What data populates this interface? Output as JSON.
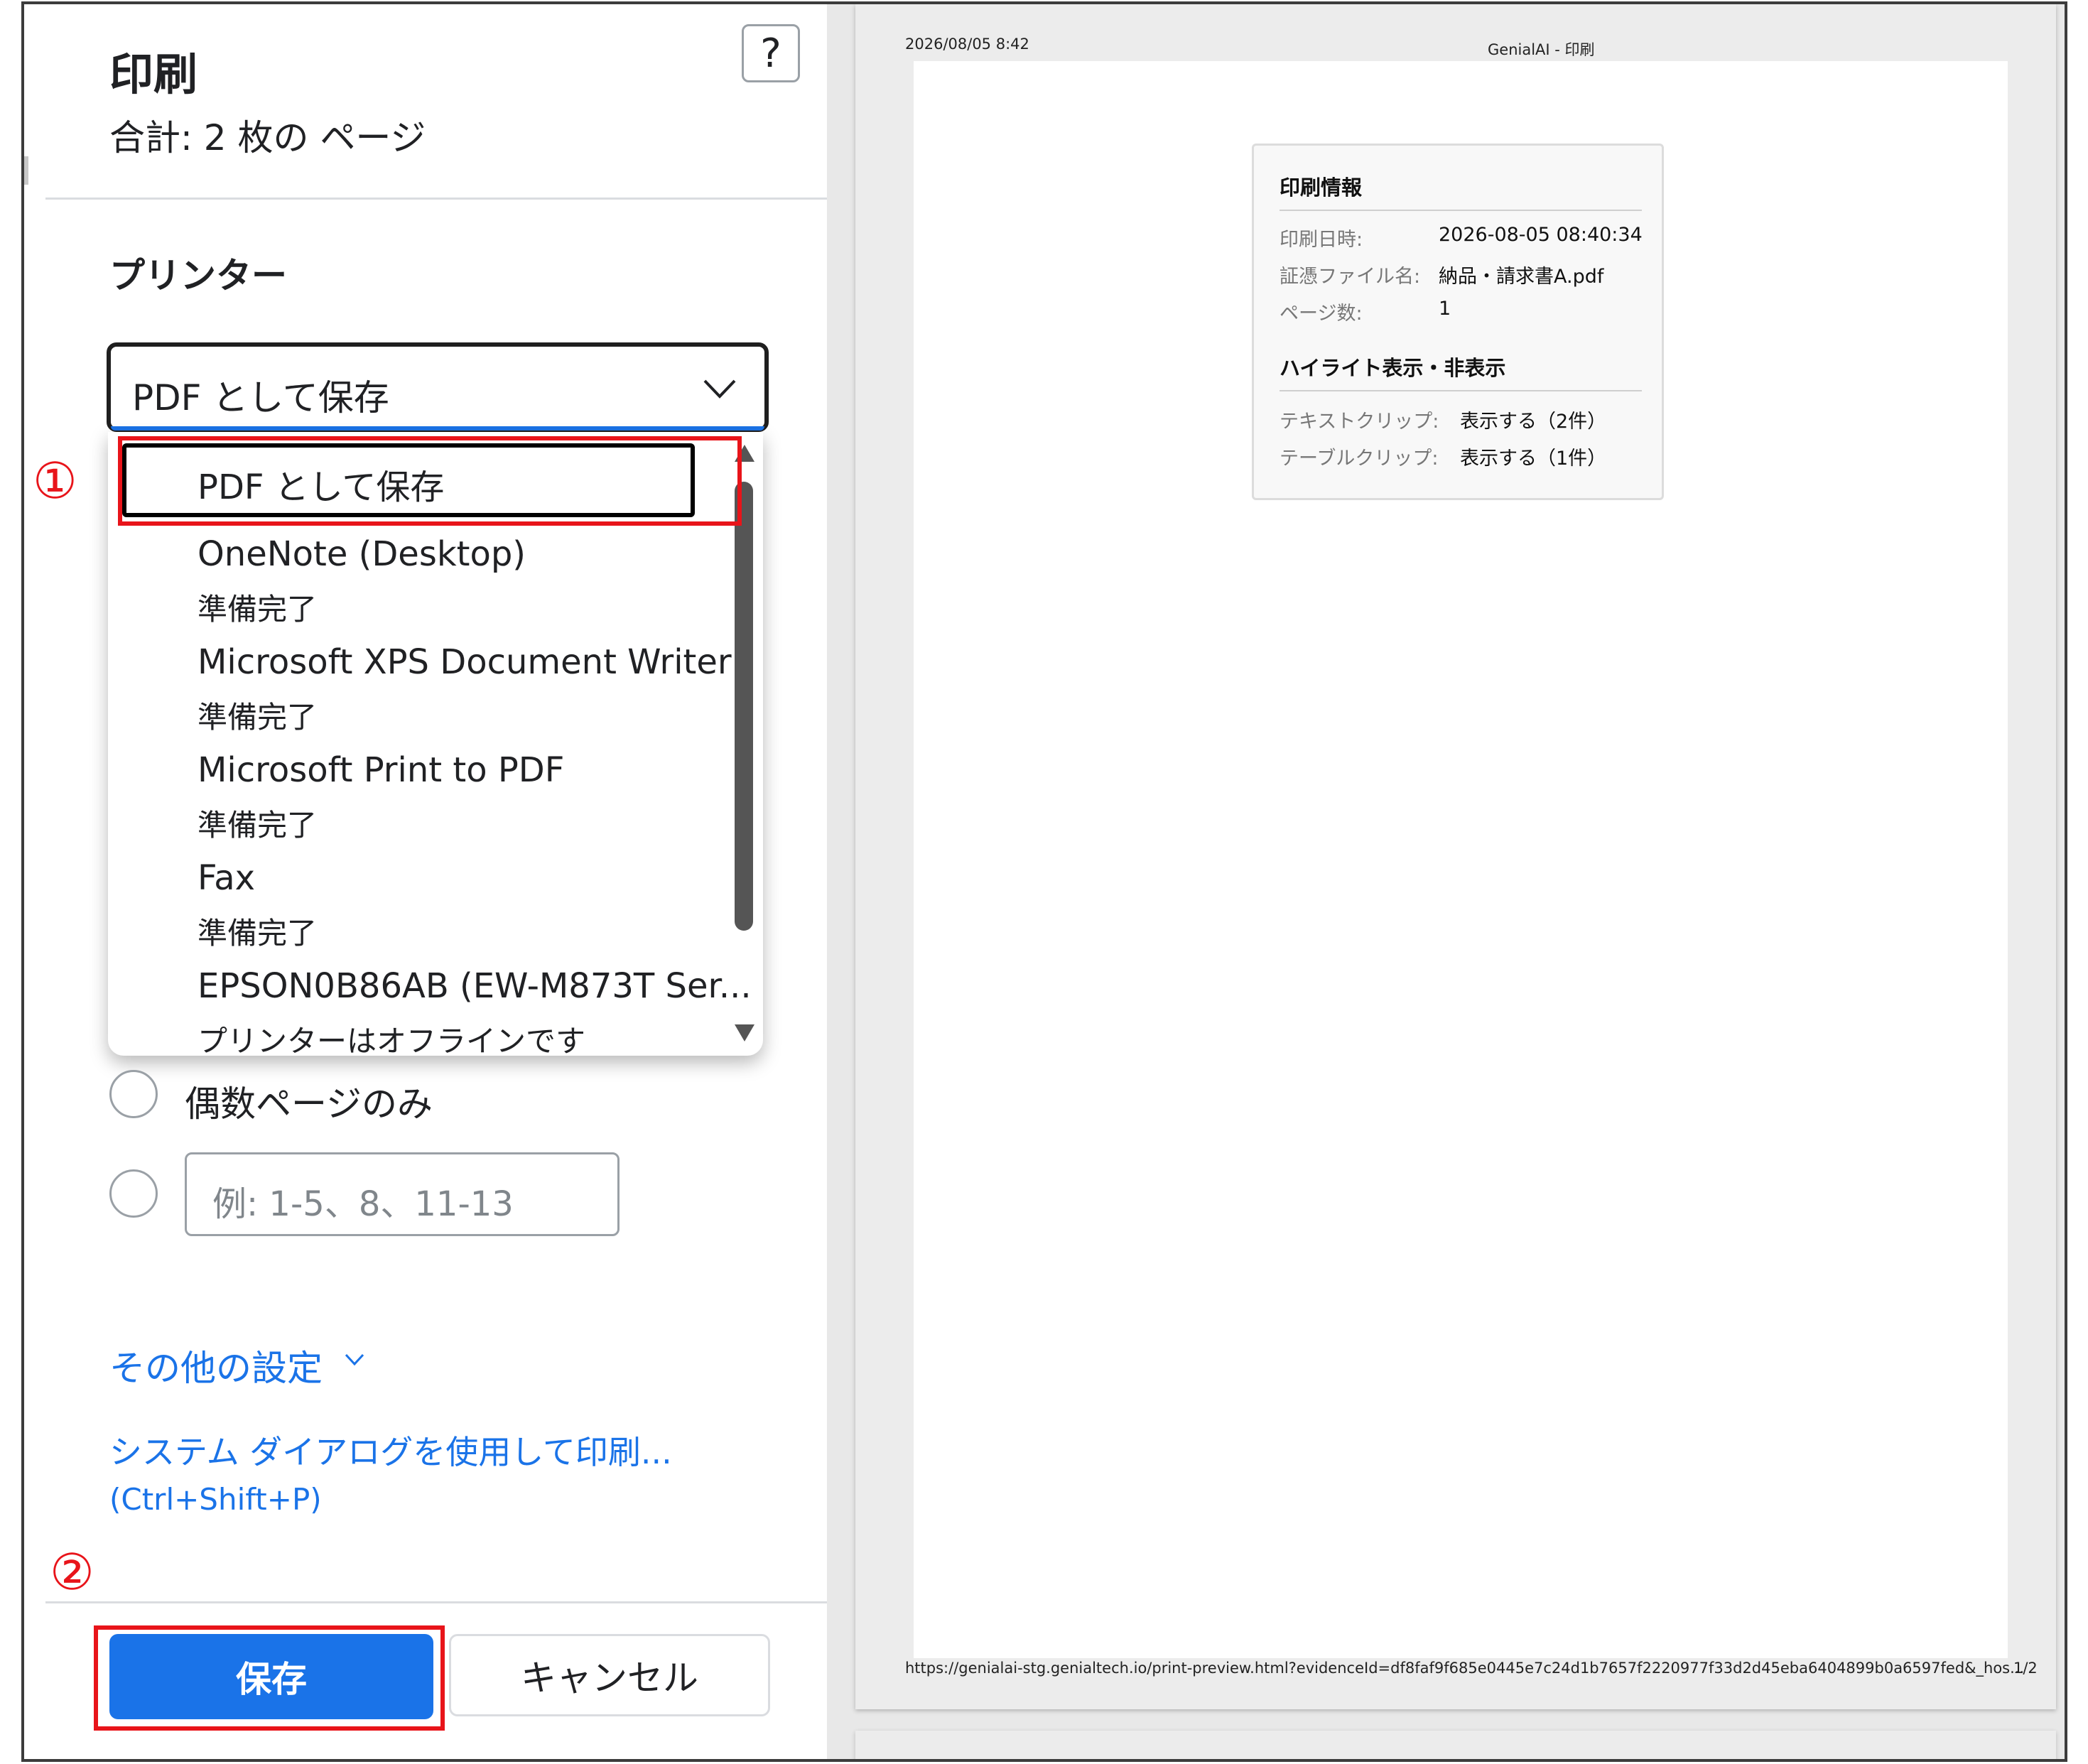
{
  "dialog": {
    "title": "印刷",
    "subtitle": "合計: 2 枚の ページ",
    "help_label": "?"
  },
  "printer": {
    "section_label": "プリンター",
    "selected": "PDF として保存",
    "options": [
      {
        "name": "PDF として保存",
        "status": ""
      },
      {
        "name": "OneNote (Desktop)",
        "status": "準備完了"
      },
      {
        "name": "Microsoft XPS Document Writer",
        "status": "準備完了"
      },
      {
        "name": "Microsoft Print to PDF",
        "status": "準備完了"
      },
      {
        "name": "Fax",
        "status": "準備完了"
      },
      {
        "name": "EPSON0B86AB (EW-M873T Ser...",
        "status": "プリンターはオフラインです"
      }
    ]
  },
  "pages": {
    "even_only_label": "偶数ページのみ",
    "custom_placeholder": "例: 1-5、8、11-13"
  },
  "links": {
    "more_settings": "その他の設定",
    "system_dialog": "システム ダイアログを使用して印刷...",
    "system_dialog_shortcut": "(Ctrl+Shift+P)"
  },
  "buttons": {
    "save": "保存",
    "cancel": "キャンセル"
  },
  "annotations": {
    "step1": "①",
    "step2": "②"
  },
  "preview": {
    "header_date": "2026/08/05 8:42",
    "header_title": "GenialAI - 印刷",
    "footer_url": "https://genialai-stg.genialtech.io/print-preview.html?evidenceId=df8faf9f685e0445e7c24d1b7657f2220977f33d2d45eba6404899b0a6597fed&_hos...",
    "footer_page": "1/2",
    "card": {
      "section1_title": "印刷情報",
      "rows": [
        {
          "key": "印刷日時:",
          "value": "2026-08-05 08:40:34"
        },
        {
          "key": "証憑ファイル名:",
          "value": "納品・請求書A.pdf"
        },
        {
          "key": "ページ数:",
          "value": "1"
        }
      ],
      "section2_title": "ハイライト表示・非表示",
      "rows2": [
        {
          "key": "テキストクリップ:",
          "value": "表示する（2件）"
        },
        {
          "key": "テーブルクリップ:",
          "value": "表示する（1件）"
        }
      ]
    }
  },
  "colors": {
    "accent": "#1a73e8",
    "callout": "#e8141a"
  }
}
